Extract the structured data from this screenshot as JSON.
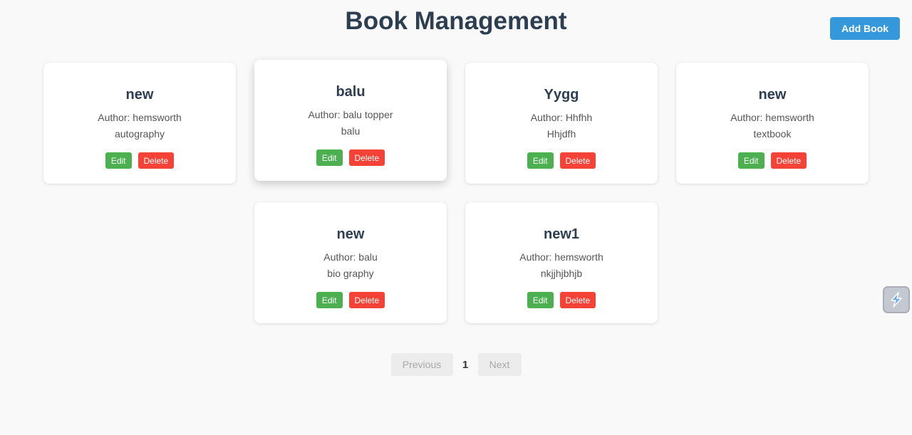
{
  "header": {
    "title": "Book Management",
    "add_label": "Add Book"
  },
  "books": [
    {
      "title": "new",
      "author": "Author: hemsworth",
      "genre": "autography"
    },
    {
      "title": "balu",
      "author": "Author: balu topper",
      "genre": "balu"
    },
    {
      "title": "Yygg",
      "author": "Author: Hhfhh",
      "genre": "Hhjdfh"
    },
    {
      "title": "new",
      "author": "Author: hemsworth",
      "genre": "textbook"
    },
    {
      "title": "new",
      "author": "Author: balu",
      "genre": "bio graphy"
    },
    {
      "title": "new1",
      "author": "Author: hemsworth",
      "genre": "nkjjhjbhjb"
    }
  ],
  "card_actions": {
    "edit_label": "Edit",
    "delete_label": "Delete"
  },
  "pagination": {
    "prev_label": "Previous",
    "current_page": "1",
    "next_label": "Next"
  },
  "colors": {
    "accent": "#3498db",
    "edit": "#4caf50",
    "delete": "#f44336",
    "title_text": "#2c3e50"
  },
  "icons": {
    "extension": "lightning-extension-icon"
  }
}
